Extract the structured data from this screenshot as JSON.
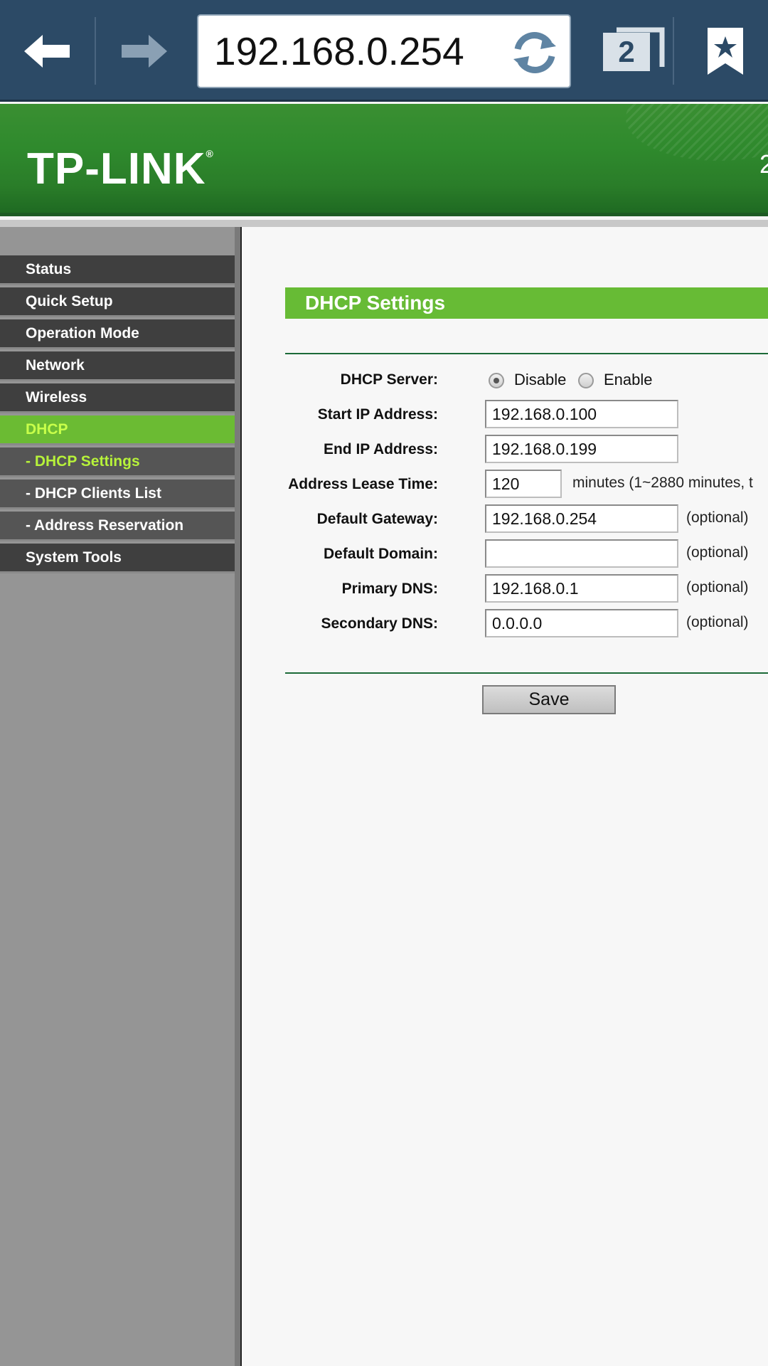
{
  "browser": {
    "url": "192.168.0.254",
    "tab_count": "2",
    "icons": [
      "back-arrow-icon",
      "forward-arrow-icon",
      "reload-icon",
      "tabs-icon",
      "bookmark-star-icon"
    ]
  },
  "header": {
    "logo": "TP-LINK",
    "logo_mark": "®",
    "edge_text": "2"
  },
  "sidebar": {
    "items": [
      {
        "label": "Status"
      },
      {
        "label": "Quick Setup"
      },
      {
        "label": "Operation Mode"
      },
      {
        "label": "Network"
      },
      {
        "label": "Wireless"
      },
      {
        "label": "DHCP"
      },
      {
        "label": "- DHCP Settings"
      },
      {
        "label": "- DHCP Clients List"
      },
      {
        "label": "- Address Reservation"
      },
      {
        "label": "System Tools"
      }
    ]
  },
  "dhcp": {
    "title": "DHCP Settings",
    "server_label": "DHCP Server:",
    "disable_label": "Disable",
    "enable_label": "Enable",
    "server_state": "Disable",
    "start_ip_label": "Start IP Address:",
    "start_ip": "192.168.0.100",
    "end_ip_label": "End IP Address:",
    "end_ip": "192.168.0.199",
    "lease_label": "Address Lease Time:",
    "lease": "120",
    "lease_hint": "minutes (1~2880 minutes, t",
    "gateway_label": "Default Gateway:",
    "gateway": "192.168.0.254",
    "domain_label": "Default Domain:",
    "domain": "",
    "primary_dns_label": "Primary DNS:",
    "primary_dns": "192.168.0.1",
    "secondary_dns_label": "Secondary DNS:",
    "secondary_dns": "0.0.0.0",
    "optional": "(optional)",
    "save_label": "Save"
  },
  "colors": {
    "browser_bar": "#2c4a66",
    "brand_green": "#2f8a2d",
    "section_green": "#67bb35",
    "sidebar_active": "#6bbb33"
  }
}
